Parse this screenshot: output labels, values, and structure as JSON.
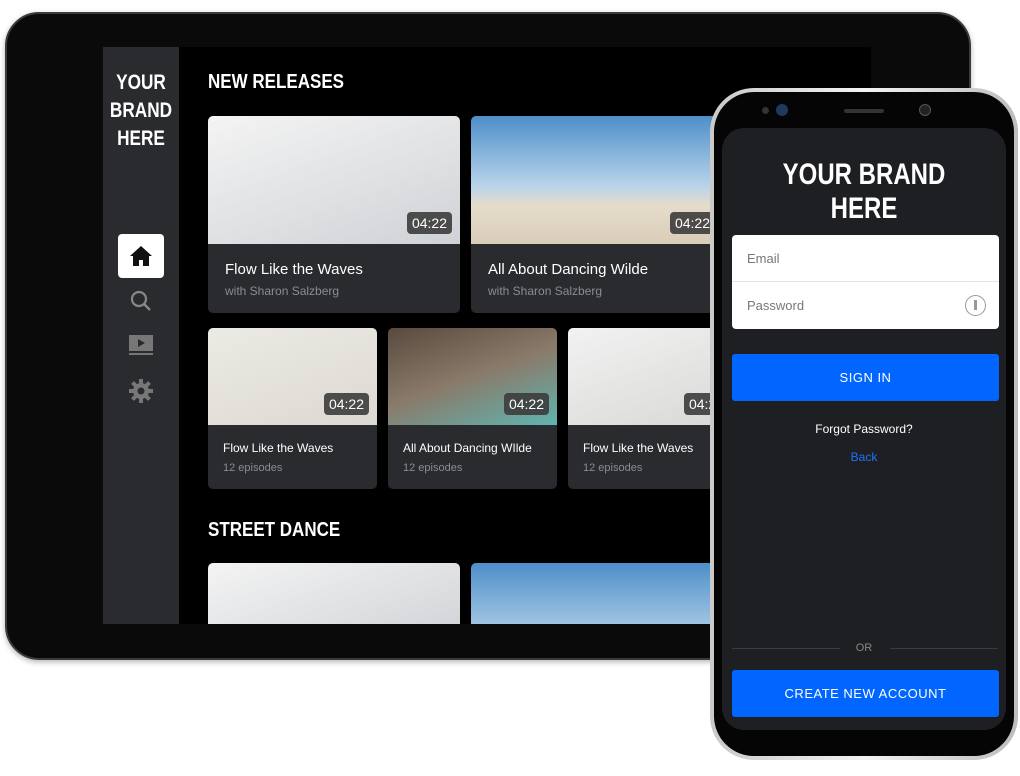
{
  "tablet": {
    "brand": [
      "YOUR",
      "BRAND",
      "HERE"
    ],
    "nav": [
      {
        "icon": "home-icon",
        "active": true
      },
      {
        "icon": "search-icon"
      },
      {
        "icon": "video-icon"
      },
      {
        "icon": "gear-icon"
      }
    ],
    "sections": [
      {
        "title": "NEW RELEASES",
        "featured": [
          {
            "title": "Flow Like the Waves",
            "subtitle": "with Sharon Salzberg",
            "duration": "04:22"
          },
          {
            "title": "All About Dancing Wilde",
            "subtitle": "with Sharon Salzberg",
            "duration": "04:22"
          }
        ],
        "series": [
          {
            "title": "Flow Like the Waves",
            "subtitle": "12 episodes",
            "duration": "04:22"
          },
          {
            "title": "All About Dancing WIlde",
            "subtitle": "12 episodes",
            "duration": "04:22"
          },
          {
            "title": "Flow Like the Waves",
            "subtitle": "12 episodes",
            "duration": "04:22"
          }
        ]
      },
      {
        "title": "STREET DANCE"
      }
    ]
  },
  "phone": {
    "brand": "YOUR BRAND HERE",
    "email_placeholder": "Email",
    "password_placeholder": "Password",
    "sign_in": "SIGN IN",
    "forgot": "Forgot Password?",
    "back": "Back",
    "or": "OR",
    "create": "CREATE NEW ACCOUNT"
  },
  "colors": {
    "accent": "#0066ff",
    "sidebar": "#2a2b2e",
    "card": "#2a2b2e",
    "phone_bg": "#1e1f22"
  }
}
